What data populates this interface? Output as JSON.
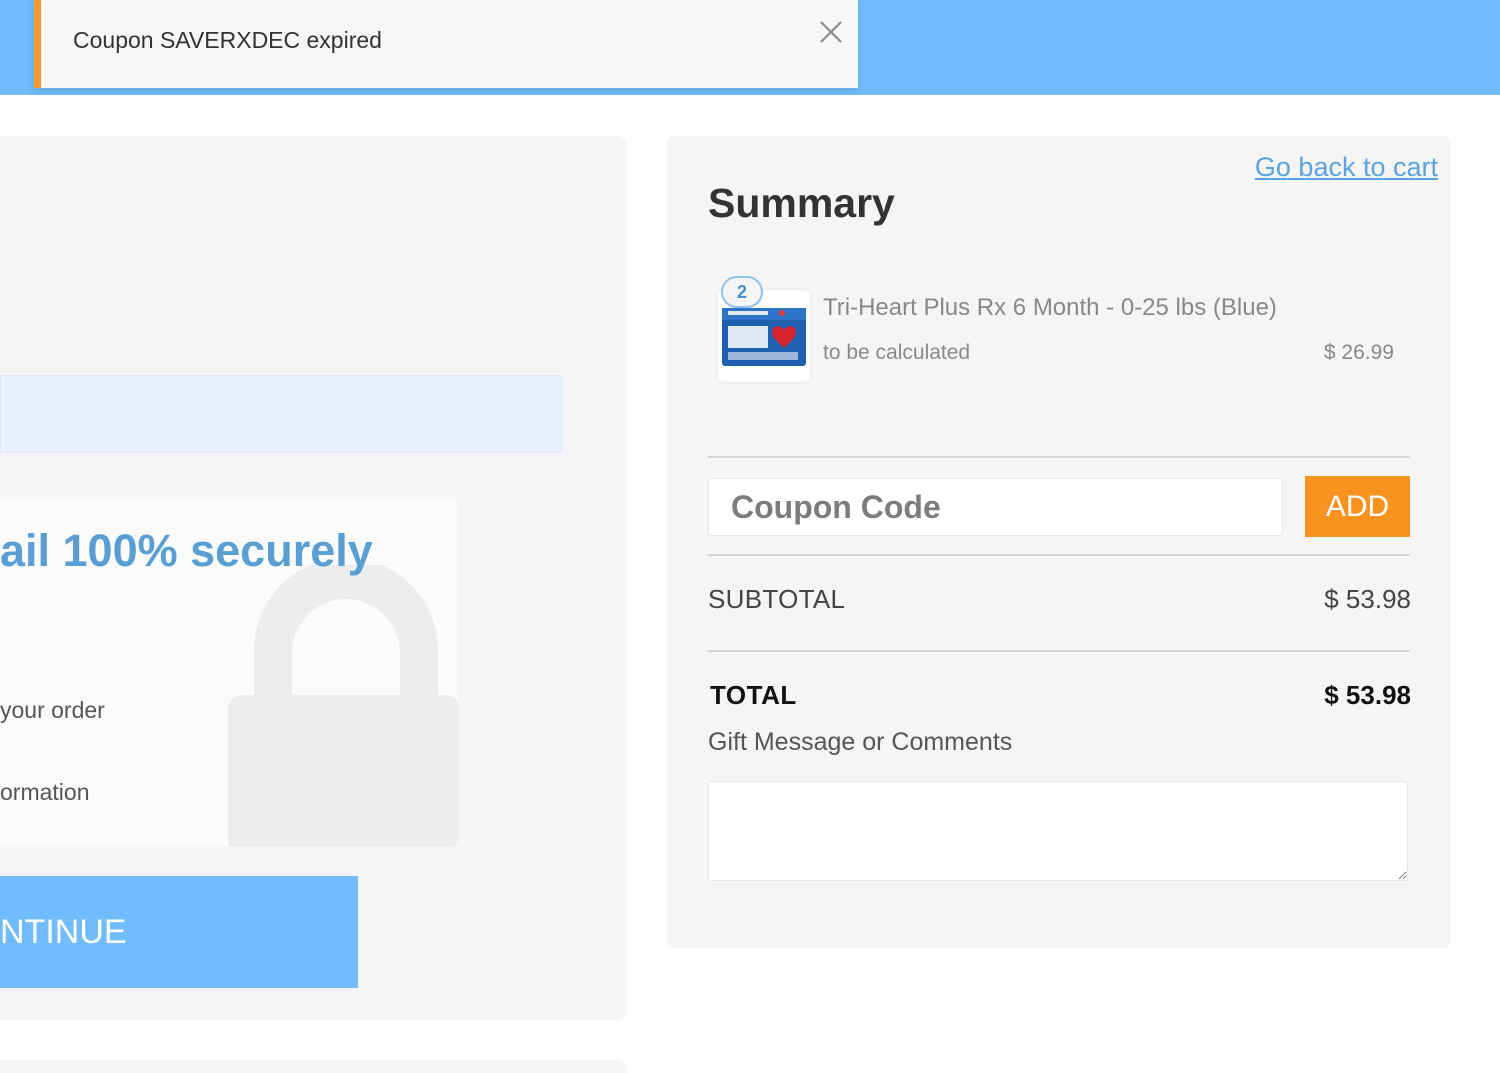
{
  "colors": {
    "header_blue": "#70bcfc",
    "toast_accent": "#f29a2e",
    "add_button": "#f7931e",
    "link_blue": "#5aa3e0",
    "secure_heading": "#5a9fd4"
  },
  "toast": {
    "message": "Coupon SAVERXDEC expired",
    "close_icon": "close-icon"
  },
  "left": {
    "secure_title": "ail 100% securely",
    "line1": "your order",
    "line2": "ormation",
    "lock_icon": "lock-icon",
    "continue_label": "NTINUE"
  },
  "summary": {
    "back_link": "Go back to cart",
    "title": "Summary",
    "item": {
      "quantity": "2",
      "name": "Tri-Heart Plus Rx 6 Month - 0-25 lbs (Blue)",
      "shipping": "to be calculated",
      "price": "$ 26.99"
    },
    "coupon": {
      "placeholder": "Coupon Code",
      "value": "",
      "add_label": "ADD"
    },
    "subtotal_label": "SUBTOTAL",
    "subtotal_value": "$ 53.98",
    "total_label": "TOTAL",
    "total_value": "$ 53.98",
    "gift_label": "Gift Message or Comments",
    "gift_value": ""
  }
}
